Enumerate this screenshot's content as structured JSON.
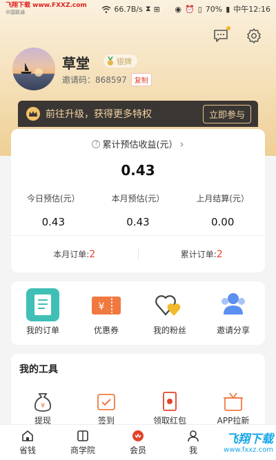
{
  "status_bar": {
    "watermark": "飞翔下载 www.FXXZ.com",
    "carrier": "中国联通",
    "speed": "66.7B/s",
    "battery": "70%",
    "time": "中午12:16"
  },
  "profile": {
    "name": "草堂",
    "level": "银牌",
    "invite_label": "邀请码：868597",
    "copy_label": "复制"
  },
  "upgrade": {
    "text": "前往升级，获得更多特权",
    "button": "立即参与"
  },
  "earnings": {
    "title": "累计预估收益(元）",
    "total": "0.43",
    "stats": [
      {
        "label": "今日预估(元）",
        "value": "0.43"
      },
      {
        "label": "本月预估(元）",
        "value": "0.43"
      },
      {
        "label": "上月结算(元）",
        "value": "0.00"
      }
    ],
    "orders": [
      {
        "label": "本月订单:",
        "value": "2"
      },
      {
        "label": "累计订单:",
        "value": "2"
      }
    ]
  },
  "quick_actions": [
    {
      "label": "我的订单",
      "icon": "order-list-icon",
      "color": "#3fbfb6"
    },
    {
      "label": "优惠券",
      "icon": "coupon-icon",
      "color": "#f0793f"
    },
    {
      "label": "我的粉丝",
      "icon": "hearts-icon",
      "color": "#f3b92a"
    },
    {
      "label": "邀请分享",
      "icon": "people-icon",
      "color": "#5b8ff0"
    }
  ],
  "tools": {
    "title": "我的工具",
    "items": [
      {
        "label": "提现",
        "icon": "money-bag-icon"
      },
      {
        "label": "签到",
        "icon": "checkin-icon"
      },
      {
        "label": "领取红包",
        "icon": "red-envelope-icon"
      },
      {
        "label": "APP拉新",
        "icon": "gift-box-icon"
      }
    ]
  },
  "tabbar": [
    {
      "label": "省钱",
      "icon": "home-icon"
    },
    {
      "label": "商学院",
      "icon": "school-icon"
    },
    {
      "label": "会员",
      "icon": "member-icon"
    },
    {
      "label": "我",
      "icon": "me-icon"
    }
  ],
  "watermark": {
    "title": "飞翔下载",
    "url": "www.fxxz.com"
  },
  "colors": {
    "accent_red": "#e2432a",
    "gold": "#f1d3a1",
    "dark_banner": "#3a3634"
  }
}
